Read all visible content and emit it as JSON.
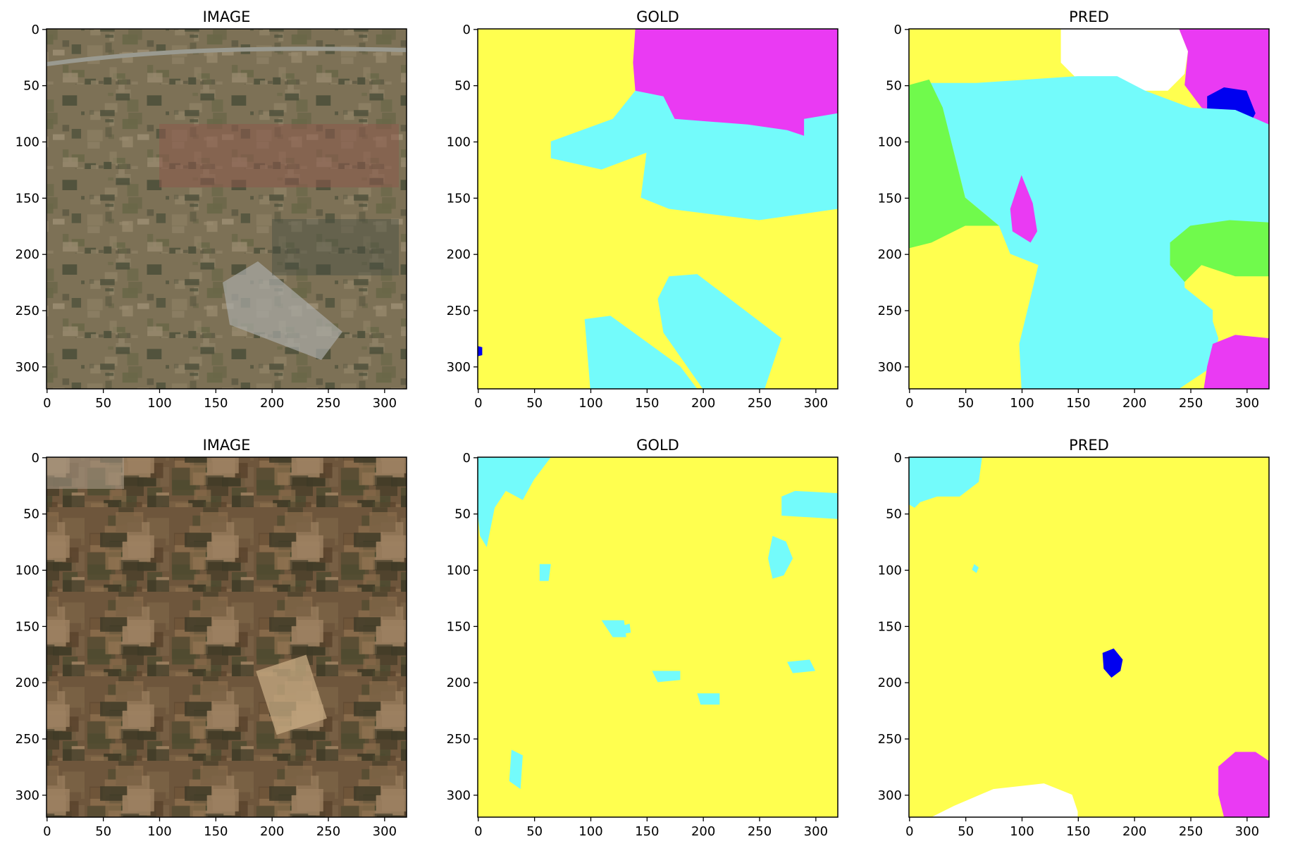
{
  "colors": {
    "yellow": "#ffff4f",
    "cyan": "#73fbfb",
    "magenta": "#ea3af3",
    "blue": "#0000f0",
    "green": "#70fa4c",
    "white": "#ffffff"
  },
  "chart_data": [
    {
      "type": "image",
      "title": "IMAGE",
      "row": 0,
      "col": 0,
      "content": "satellite",
      "xlim": [
        0,
        320
      ],
      "ylim": [
        320,
        0
      ],
      "xticks": [
        "0",
        "50",
        "100",
        "150",
        "200",
        "250",
        "300"
      ],
      "yticks": [
        "0",
        "50",
        "100",
        "150",
        "200",
        "250",
        "300"
      ],
      "grid": false
    },
    {
      "type": "image",
      "title": "GOLD",
      "row": 0,
      "col": 1,
      "content": "mask",
      "xlim": [
        0,
        320
      ],
      "ylim": [
        320,
        0
      ],
      "xticks": [
        "0",
        "50",
        "100",
        "150",
        "200",
        "250",
        "300"
      ],
      "yticks": [
        "0",
        "50",
        "100",
        "150",
        "200",
        "250",
        "300"
      ],
      "grid": false
    },
    {
      "type": "image",
      "title": "PRED",
      "row": 0,
      "col": 2,
      "content": "mask",
      "xlim": [
        0,
        320
      ],
      "ylim": [
        320,
        0
      ],
      "xticks": [
        "0",
        "50",
        "100",
        "150",
        "200",
        "250",
        "300"
      ],
      "yticks": [
        "0",
        "50",
        "100",
        "150",
        "200",
        "250",
        "300"
      ],
      "grid": false
    },
    {
      "type": "image",
      "title": "IMAGE",
      "row": 1,
      "col": 0,
      "content": "satellite",
      "xlim": [
        0,
        320
      ],
      "ylim": [
        320,
        0
      ],
      "xticks": [
        "0",
        "50",
        "100",
        "150",
        "200",
        "250",
        "300"
      ],
      "yticks": [
        "0",
        "50",
        "100",
        "150",
        "200",
        "250",
        "300"
      ],
      "grid": false
    },
    {
      "type": "image",
      "title": "GOLD",
      "row": 1,
      "col": 1,
      "content": "mask",
      "xlim": [
        0,
        320
      ],
      "ylim": [
        320,
        0
      ],
      "xticks": [
        "0",
        "50",
        "100",
        "150",
        "200",
        "250",
        "300"
      ],
      "yticks": [
        "0",
        "50",
        "100",
        "150",
        "200",
        "250",
        "300"
      ],
      "grid": false
    },
    {
      "type": "image",
      "title": "PRED",
      "row": 1,
      "col": 2,
      "content": "mask",
      "xlim": [
        0,
        320
      ],
      "ylim": [
        320,
        0
      ],
      "xticks": [
        "0",
        "50",
        "100",
        "150",
        "200",
        "250",
        "300"
      ],
      "yticks": [
        "0",
        "50",
        "100",
        "150",
        "200",
        "250",
        "300"
      ],
      "grid": false
    }
  ]
}
